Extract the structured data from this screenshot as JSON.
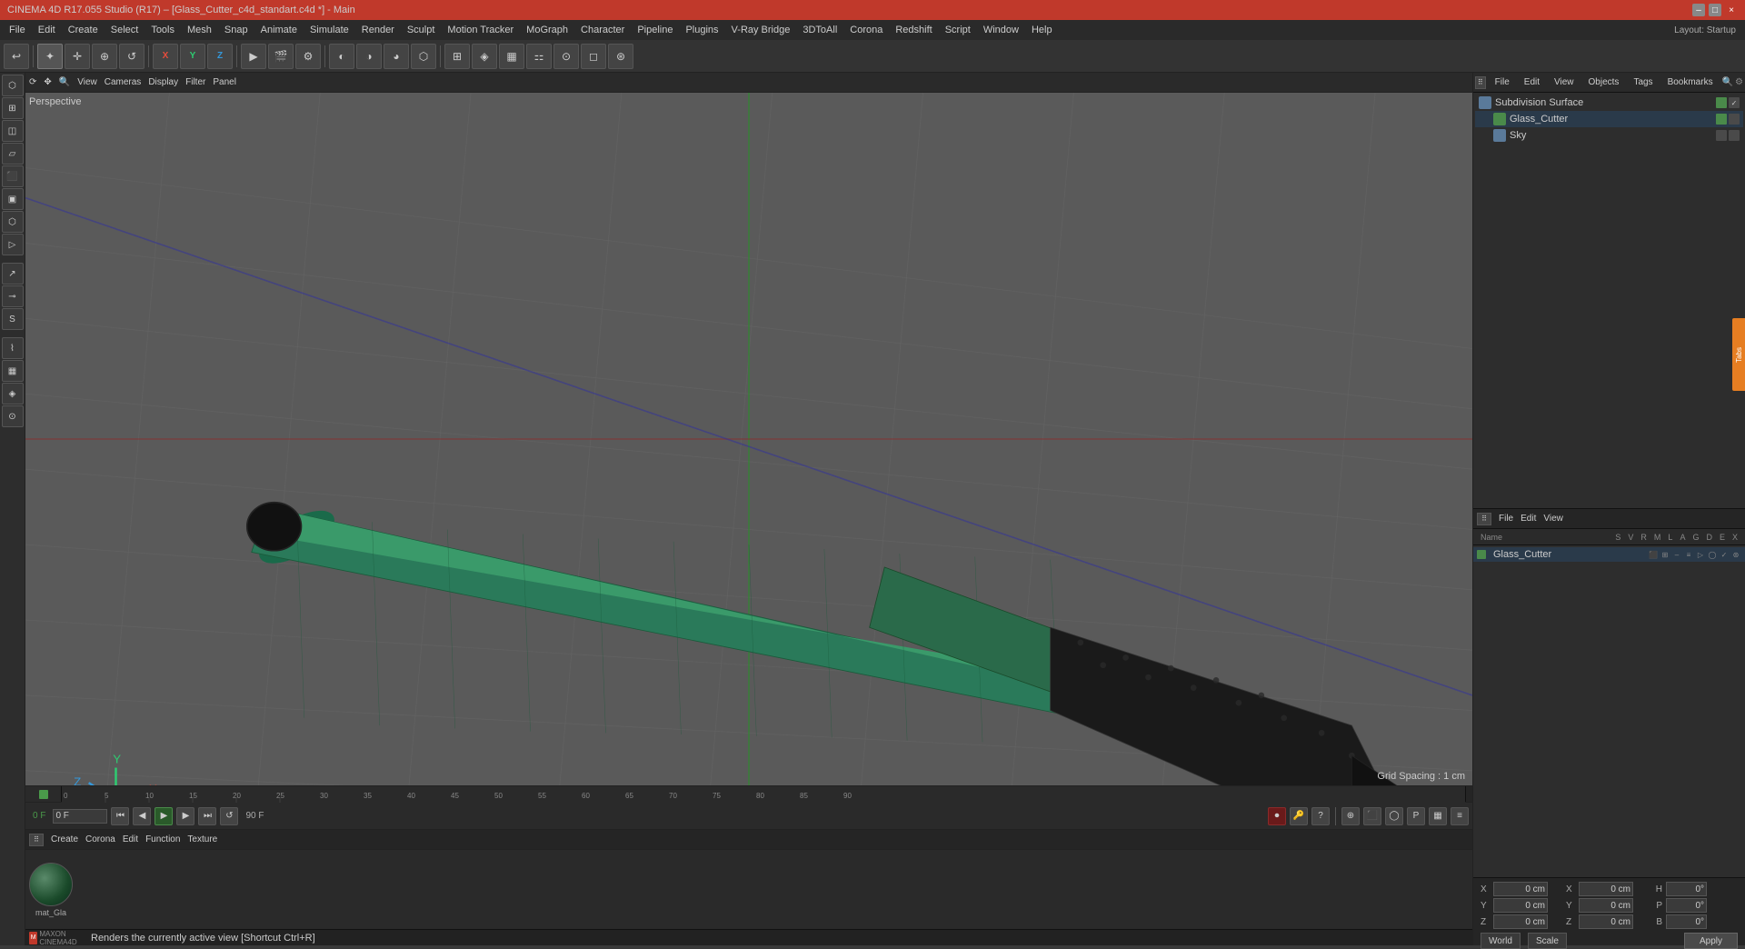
{
  "titlebar": {
    "title": "CINEMA 4D R17.055 Studio (R17) – [Glass_Cutter_c4d_standart.c4d *] - Main",
    "controls": [
      "–",
      "□",
      "×"
    ]
  },
  "menubar": {
    "items": [
      "File",
      "Edit",
      "Create",
      "Select",
      "Tools",
      "Mesh",
      "Snap",
      "Animate",
      "Simulate",
      "Render",
      "Sculpt",
      "Motion Tracker",
      "MoGraph",
      "Character",
      "Pipeline",
      "Plugins",
      "V-Ray Bridge",
      "3DToAll",
      "Corona",
      "Redshift",
      "Script",
      "Window",
      "Help"
    ],
    "layout_label": "Layout: Startup"
  },
  "toolbar": {
    "tools": [
      "↩",
      "✦",
      "✛",
      "⊕",
      "↺",
      "⬜",
      "⟳",
      "X",
      "Y",
      "Z",
      "▦",
      "▸",
      "⬛",
      "🎬",
      "📷",
      "◐",
      "◑",
      "◕",
      "⚙",
      "🔘",
      "◈",
      "⬡",
      "⚏",
      "⊞",
      "▦"
    ]
  },
  "viewport": {
    "label": "Perspective",
    "grid_spacing": "Grid Spacing : 1 cm",
    "top_bar": [
      "View",
      "Cameras",
      "Display",
      "Filter",
      "Panel"
    ],
    "nav_icons": [
      "⟳",
      "↕",
      "⊙"
    ]
  },
  "object_manager": {
    "toolbar": [
      "File",
      "Edit",
      "View",
      "Objects",
      "Tags",
      "Bookmarks"
    ],
    "objects": [
      {
        "name": "Subdivision Surface",
        "icon_color": "#5a7a9a",
        "has_green": true,
        "has_check": true
      },
      {
        "name": "Glass_Cutter",
        "icon_color": "#4a8a4a",
        "indent": 1,
        "has_green": true
      },
      {
        "name": "Sky",
        "icon_color": "#5a7a9a",
        "indent": 1
      }
    ]
  },
  "attribute_manager": {
    "toolbar": [
      "File",
      "Edit",
      "View"
    ],
    "columns": [
      "Name",
      "S",
      "V",
      "R",
      "M",
      "L",
      "A",
      "G",
      "D",
      "E",
      "X"
    ],
    "items": [
      {
        "name": "Glass_Cutter",
        "icon_color": "#4a8a4a"
      }
    ]
  },
  "coordinates": {
    "x_label": "X",
    "x_value": "0 cm",
    "y_label": "Y",
    "y_value": "0 cm",
    "z_label": "Z",
    "z_value": "0 cm",
    "rx_label": "X",
    "rx_value": "0 cm",
    "ry_label": "Y",
    "ry_value": "0 cm",
    "rz_label": "Z",
    "rz_value": "0 cm",
    "h_label": "H",
    "h_value": "0°",
    "p_label": "P",
    "p_value": "0°",
    "b_label": "B",
    "b_value": "0°",
    "world_label": "World",
    "scale_label": "Scale",
    "apply_label": "Apply"
  },
  "material_editor": {
    "toolbar": [
      "Create",
      "Corona",
      "Edit",
      "Function",
      "Texture"
    ],
    "material_name": "mat_Gla"
  },
  "timeline": {
    "markers": [
      "0",
      "5",
      "10",
      "15",
      "20",
      "25",
      "30",
      "35",
      "40",
      "45",
      "50",
      "55",
      "60",
      "65",
      "70",
      "75",
      "80",
      "85",
      "90"
    ],
    "current_frame": "0 F",
    "end_frame": "90 F"
  },
  "status_bar": {
    "text": "Renders the currently active view [Shortcut Ctrl+R]"
  },
  "right_tab": {
    "label": "Tabs"
  }
}
